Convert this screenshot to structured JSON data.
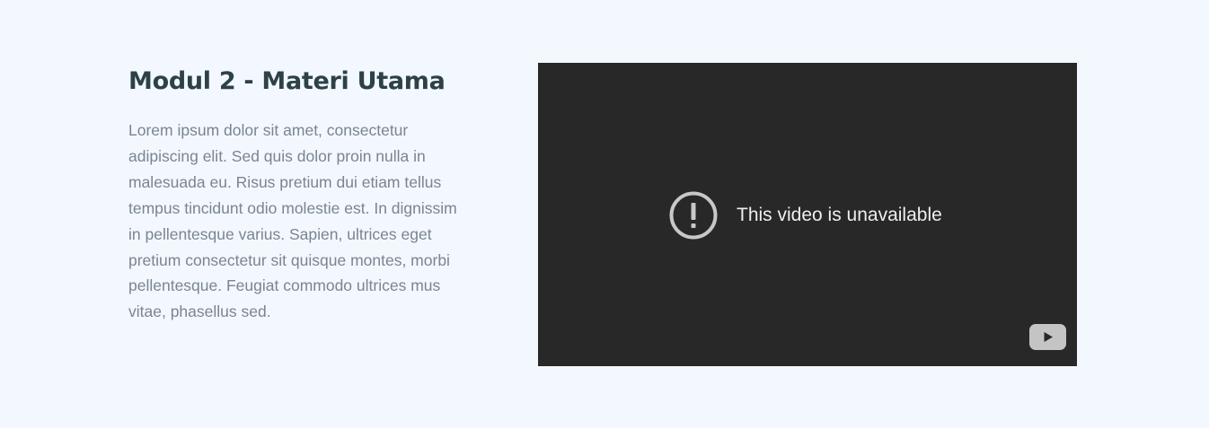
{
  "module": {
    "title": "Modul 2 - Materi Utama",
    "description": "Lorem ipsum dolor sit amet, consectetur adipiscing elit. Sed quis dolor proin nulla in malesuada eu. Risus pretium dui etiam tellus tempus tincidunt odio molestie est. In dignissim in pellentesque varius. Sapien, ultrices eget pretium consectetur sit quisque montes, morbi pellentesque. Feugiat commodo ultrices mus vitae, phasellus sed."
  },
  "video": {
    "message": "This video is unavailable",
    "status_icon": "alert-circle-icon",
    "brand_icon": "youtube-logo-icon"
  },
  "colors": {
    "page_background": "#f3f8ff",
    "heading": "#2d4147",
    "body_text": "#7a8590",
    "video_background": "#282828"
  }
}
